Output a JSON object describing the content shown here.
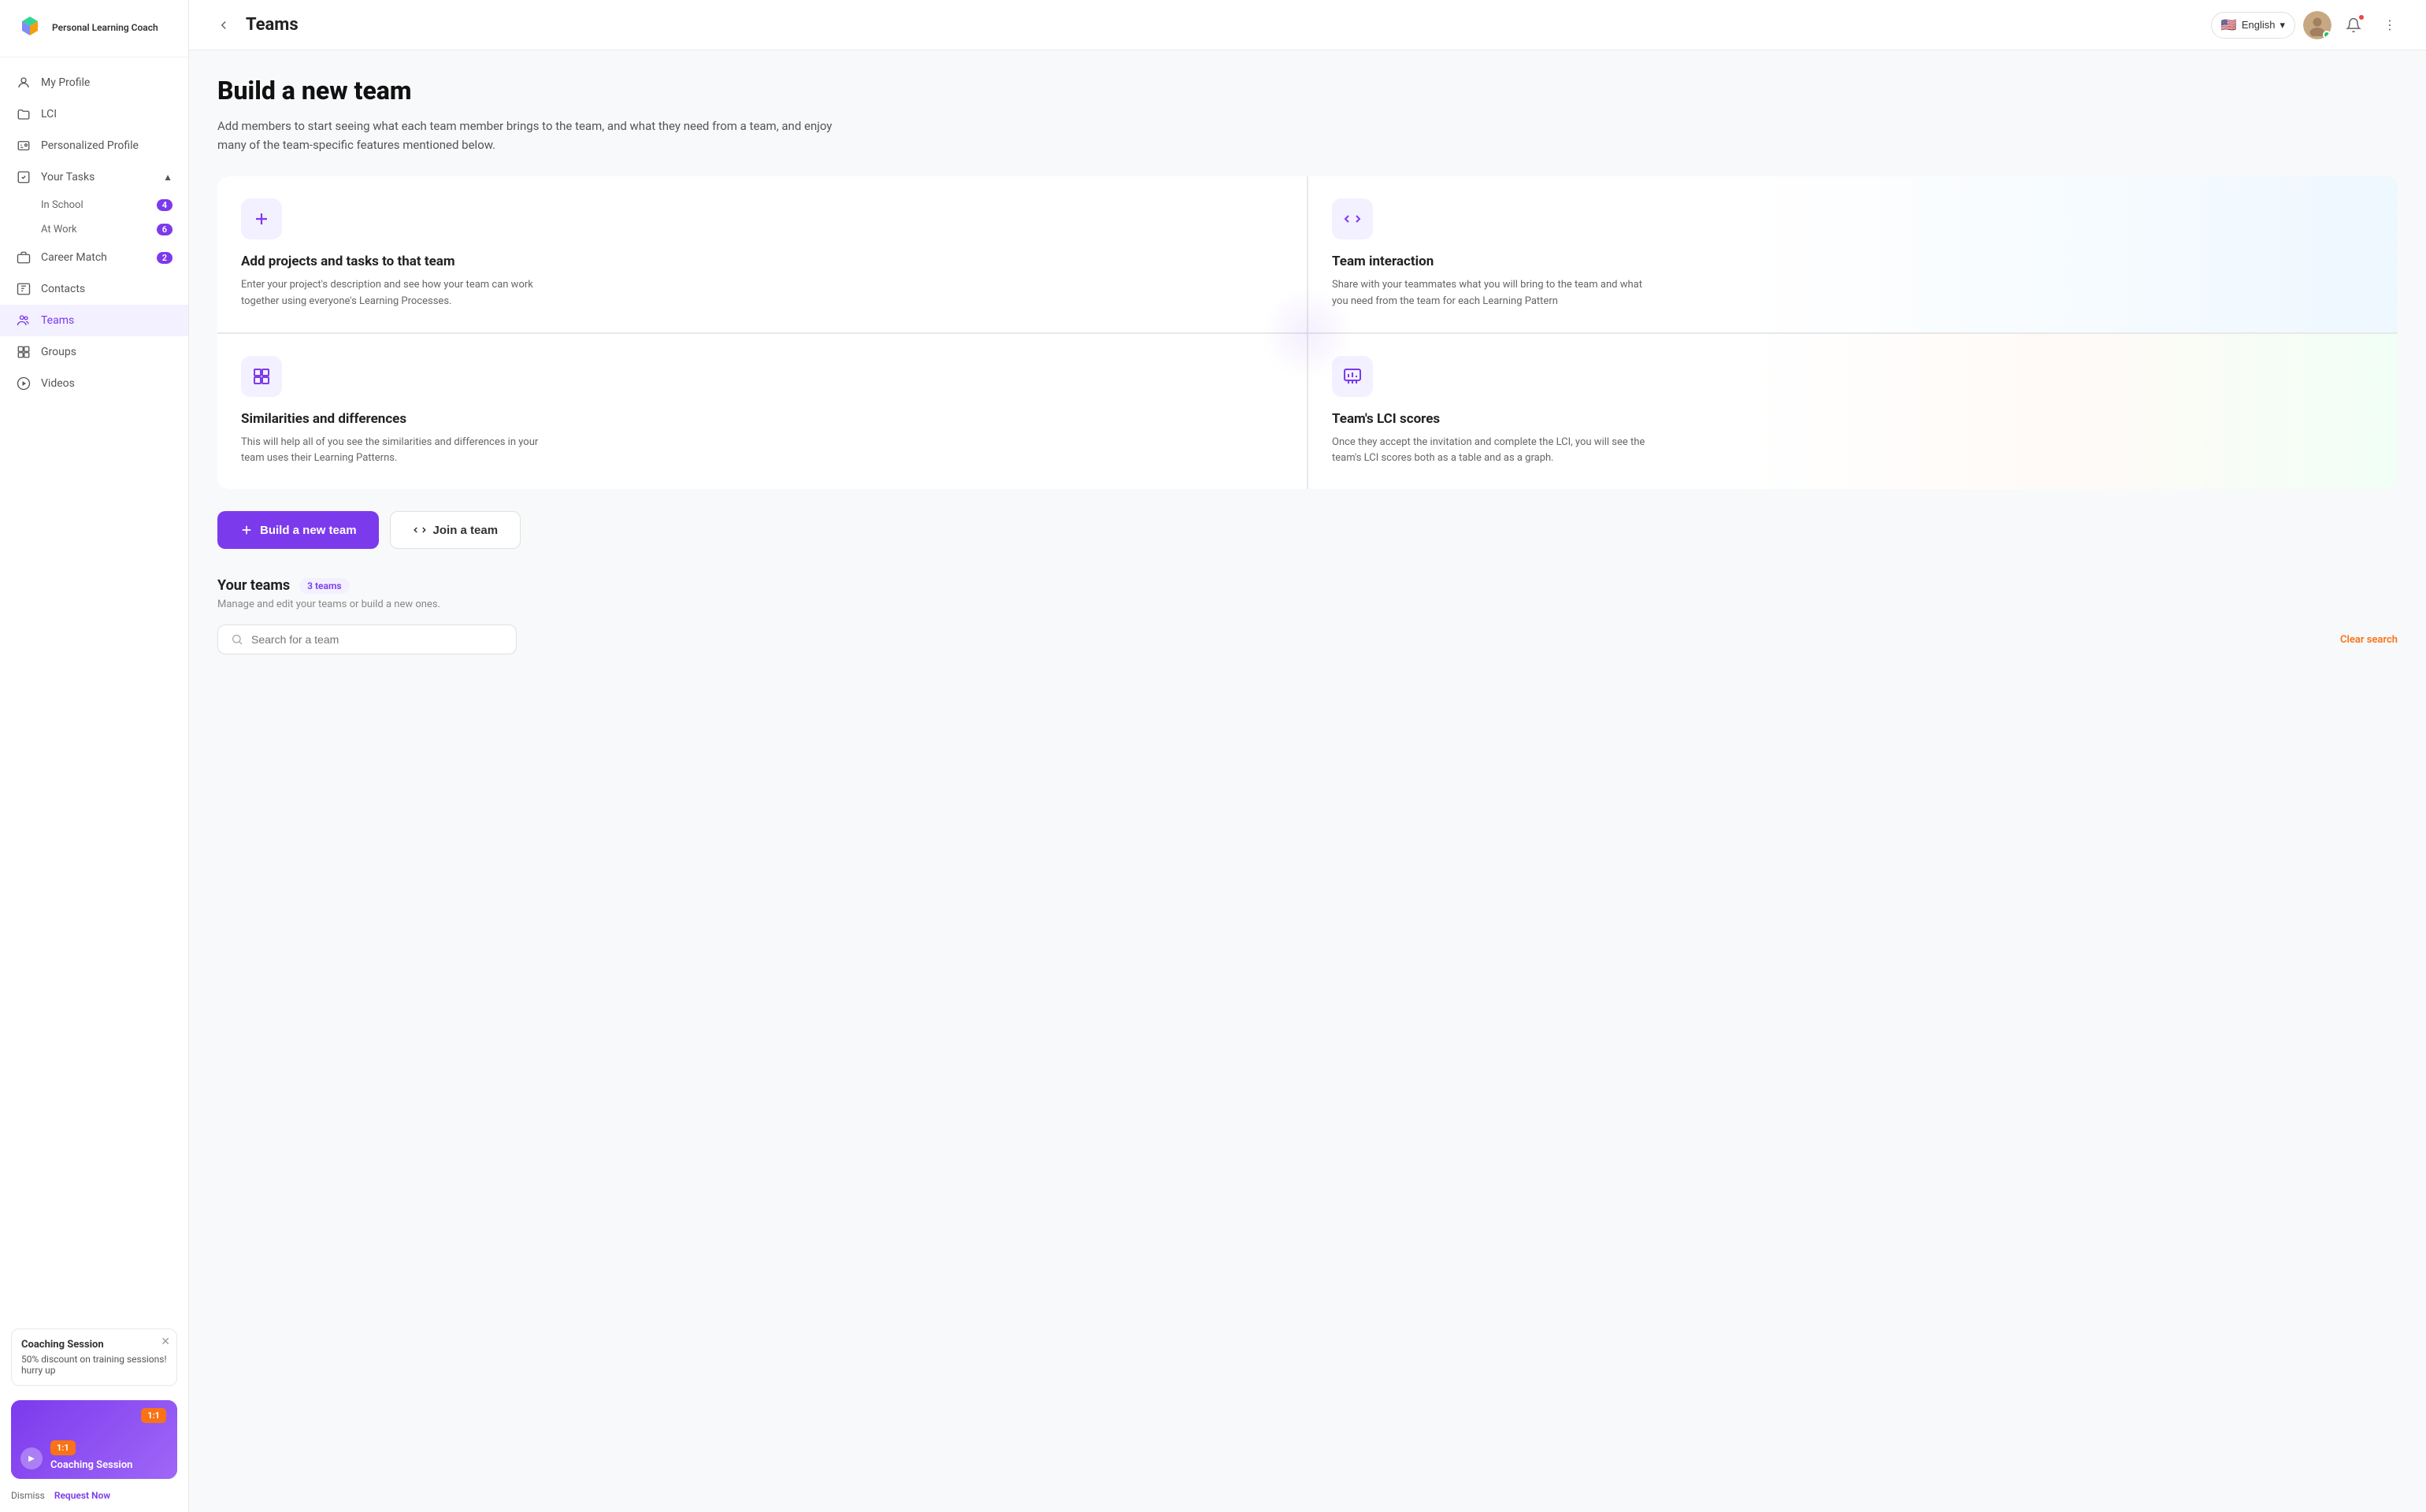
{
  "app": {
    "name": "Personal Learning Coach",
    "logo_lines": [
      "Personal",
      "Learning",
      "Coach"
    ]
  },
  "header": {
    "collapse_icon": "‹",
    "page_title": "Teams",
    "language": "English",
    "language_flag": "🇺🇸",
    "more_icon": "⋮"
  },
  "sidebar": {
    "items": [
      {
        "id": "my-profile",
        "label": "My Profile",
        "icon": "👤",
        "badge": null
      },
      {
        "id": "lci",
        "label": "LCI",
        "icon": "📁",
        "badge": null
      },
      {
        "id": "personalized-profile",
        "label": "Personalized Profile",
        "icon": "🪪",
        "badge": null
      },
      {
        "id": "your-tasks",
        "label": "Your Tasks",
        "icon": "📋",
        "badge": null,
        "expanded": true
      },
      {
        "id": "career-match",
        "label": "Career Match",
        "icon": "💼",
        "badge": "2"
      },
      {
        "id": "contacts",
        "label": "Contacts",
        "icon": "📒",
        "badge": null
      },
      {
        "id": "teams",
        "label": "Teams",
        "icon": "👥",
        "badge": null,
        "active": true
      },
      {
        "id": "groups",
        "label": "Groups",
        "icon": "⚏",
        "badge": null
      },
      {
        "id": "videos",
        "label": "Videos",
        "icon": "▶",
        "badge": null
      }
    ],
    "sub_items": [
      {
        "label": "In School",
        "badge": "4"
      },
      {
        "label": "At Work",
        "badge": "6"
      }
    ],
    "coaching_session": {
      "title": "Coaching Session",
      "description": "50% discount on training sessions! hurry up",
      "banner_label": "1:1",
      "banner_title": "Coaching Session",
      "dismiss_label": "Dismiss",
      "request_label": "Request Now"
    }
  },
  "main": {
    "build_title": "Build a new team",
    "build_desc": "Add members to start seeing what each team member brings to the team, and what they need from a team, and enjoy many of the team-specific features mentioned below.",
    "feature_cards": [
      {
        "id": "add-projects",
        "icon": "+",
        "title": "Add projects and tasks to that team",
        "desc": "Enter your project's description and see how your team can work together using everyone's Learning Processes.",
        "position": "tl"
      },
      {
        "id": "team-interaction",
        "icon": "⇄",
        "title": "Team interaction",
        "desc": "Share with your teammates what you will bring to the team and what you need from the team for each Learning Pattern",
        "position": "tr"
      },
      {
        "id": "similarities",
        "icon": "⊞",
        "title": "Similarities and differences",
        "desc": "This will help all of you see the similarities and differences in your team uses their Learning Patterns.",
        "position": "bl"
      },
      {
        "id": "lci-scores",
        "icon": "📊",
        "title": "Team's LCI scores",
        "desc": "Once they accept the invitation and complete the LCI, you will see the team's LCI scores both as a table and as a graph.",
        "position": "br"
      }
    ],
    "build_btn_label": "+ Build a new team",
    "join_btn_label": "⇄ Join a team",
    "your_teams": {
      "title": "Your teams",
      "count": "3 teams",
      "desc": "Manage and edit your teams or build a new ones.",
      "search_placeholder": "Search for a team",
      "clear_search_label": "Clear search"
    }
  }
}
